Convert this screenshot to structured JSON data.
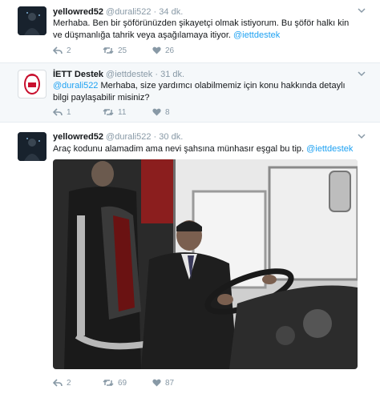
{
  "tweets": [
    {
      "name": "yellowred52",
      "handle": "@durali522",
      "time": "34 dk.",
      "text": "Merhaba. Ben bir şöförünüzden şikayetçi olmak istiyorum. Bu şöför halkı kin ve düşmanlığa tahrik veya aşağılamaya itiyor.",
      "mention": "@iettdestek",
      "reply_count": "2",
      "retweet_count": "25",
      "like_count": "26"
    },
    {
      "name": "İETT Destek",
      "handle": "@iettdestek",
      "time": "31 dk.",
      "mention": "@durali522",
      "text": "Merhaba, size yardımcı olabilmemiz için konu hakkında detaylı bilgi paylaşabilir misiniz?",
      "avatar_text": "İETT",
      "reply_count": "1",
      "retweet_count": "11",
      "like_count": "8"
    },
    {
      "name": "yellowred52",
      "handle": "@durali522",
      "time": "30 dk.",
      "text": "Araç kodunu alamadim ama nevi şahsına münhasır eşgal bu tip.",
      "mention": "@iettdestek",
      "reply_count": "2",
      "retweet_count": "69",
      "like_count": "87"
    }
  ],
  "separator": "·",
  "colors": {
    "link": "#1da1f2",
    "muted": "#8899a6",
    "like": "#8899a6"
  },
  "icons": [
    "reply-icon",
    "retweet-icon",
    "like-icon",
    "chevron-down-icon"
  ]
}
